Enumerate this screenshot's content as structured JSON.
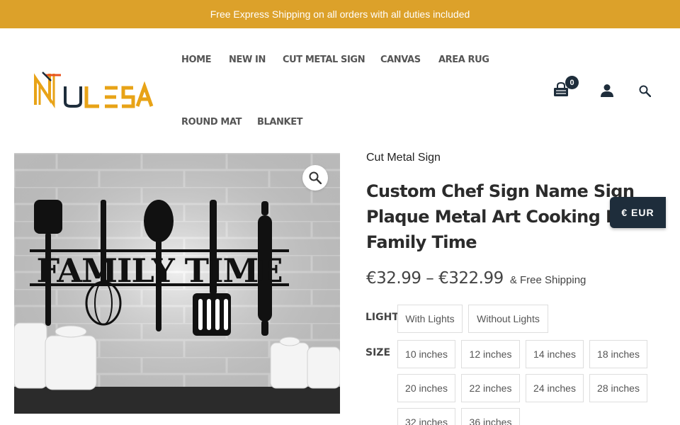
{
  "announcement": "Free Express Shipping on all orders with all duties included",
  "brand": {
    "name": "NULESA",
    "accent": "#e8a317",
    "dark": "#1e2d3b"
  },
  "nav": {
    "items": [
      "HOME",
      "NEW IN",
      "CUT METAL SIGN",
      "CANVAS",
      "AREA RUG",
      "ROUND MAT",
      "BLANKET"
    ]
  },
  "header": {
    "cart_icon": "shopping-bag-icon",
    "cart_count": "0",
    "account_icon": "user-icon",
    "search_icon": "search-icon"
  },
  "product": {
    "image_text": "FAMILY TIME",
    "zoom_icon": "magnifier-icon",
    "category": "Cut Metal Sign",
    "title_lines": [
      "Custom Chef Sign Name Sign",
      "Plaque Metal Art Cooking Dec",
      "Family Time"
    ],
    "price_range": "€32.99 – €322.99",
    "shipping": "& Free Shipping"
  },
  "currency": {
    "label": "€ EUR"
  },
  "options": {
    "light": {
      "label": "LIGHT",
      "values": [
        "With Lights",
        "Without Lights"
      ]
    },
    "size": {
      "label": "SIZE",
      "values": [
        "10 inches",
        "12 inches",
        "14 inches",
        "18 inches",
        "20 inches",
        "22 inches",
        "24 inches",
        "28 inches",
        "32 inches",
        "36 inches"
      ]
    }
  },
  "colors": {
    "topbar": "#dca12a",
    "currency_button": "#1e2d3b"
  }
}
